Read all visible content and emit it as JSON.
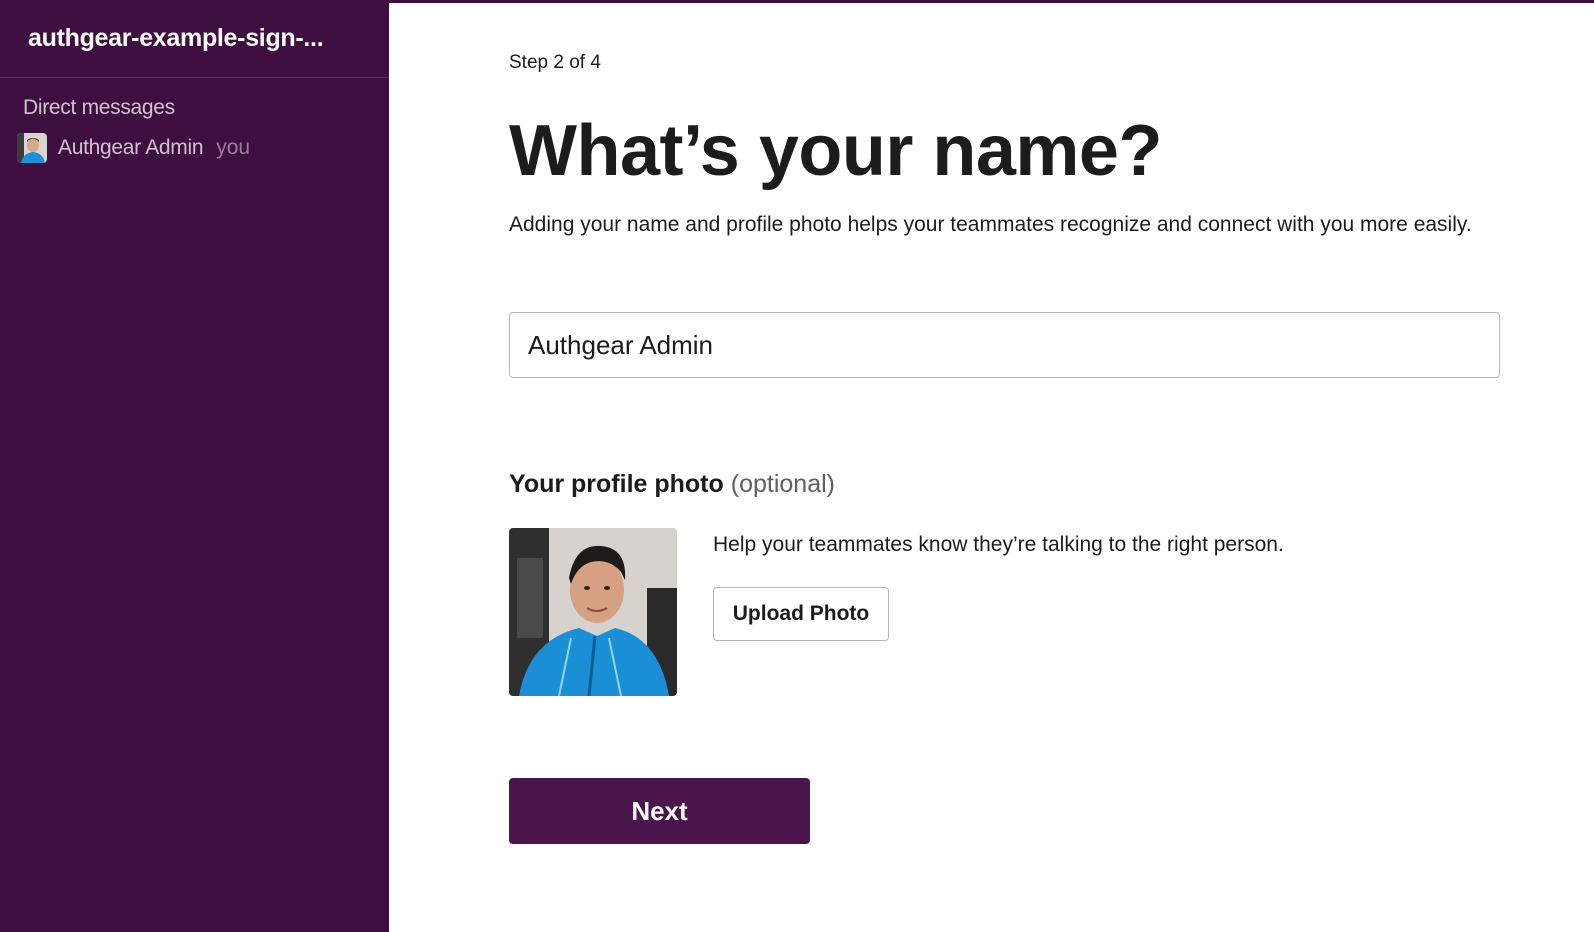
{
  "sidebar": {
    "workspace_name": "authgear-example-sign-...",
    "section_title": "Direct messages",
    "dm_items": [
      {
        "name": "Authgear Admin",
        "suffix": "you",
        "avatar_icon": "user-photo-avatar"
      }
    ]
  },
  "main": {
    "step": "Step 2 of 4",
    "title": "What’s your name?",
    "description": "Adding your name and profile photo helps your teammates recognize and connect with you more easily.",
    "name_input": {
      "value": "Authgear Admin",
      "placeholder": ""
    },
    "photo_section": {
      "heading": "Your profile photo",
      "optional": "(optional)",
      "help_text": "Help your teammates know they’re talking to the right person.",
      "upload_label": "Upload Photo"
    },
    "next_label": "Next"
  },
  "colors": {
    "sidebar_bg": "#3f0e40",
    "primary_button": "#4a154b",
    "text": "#1d1c1d"
  }
}
